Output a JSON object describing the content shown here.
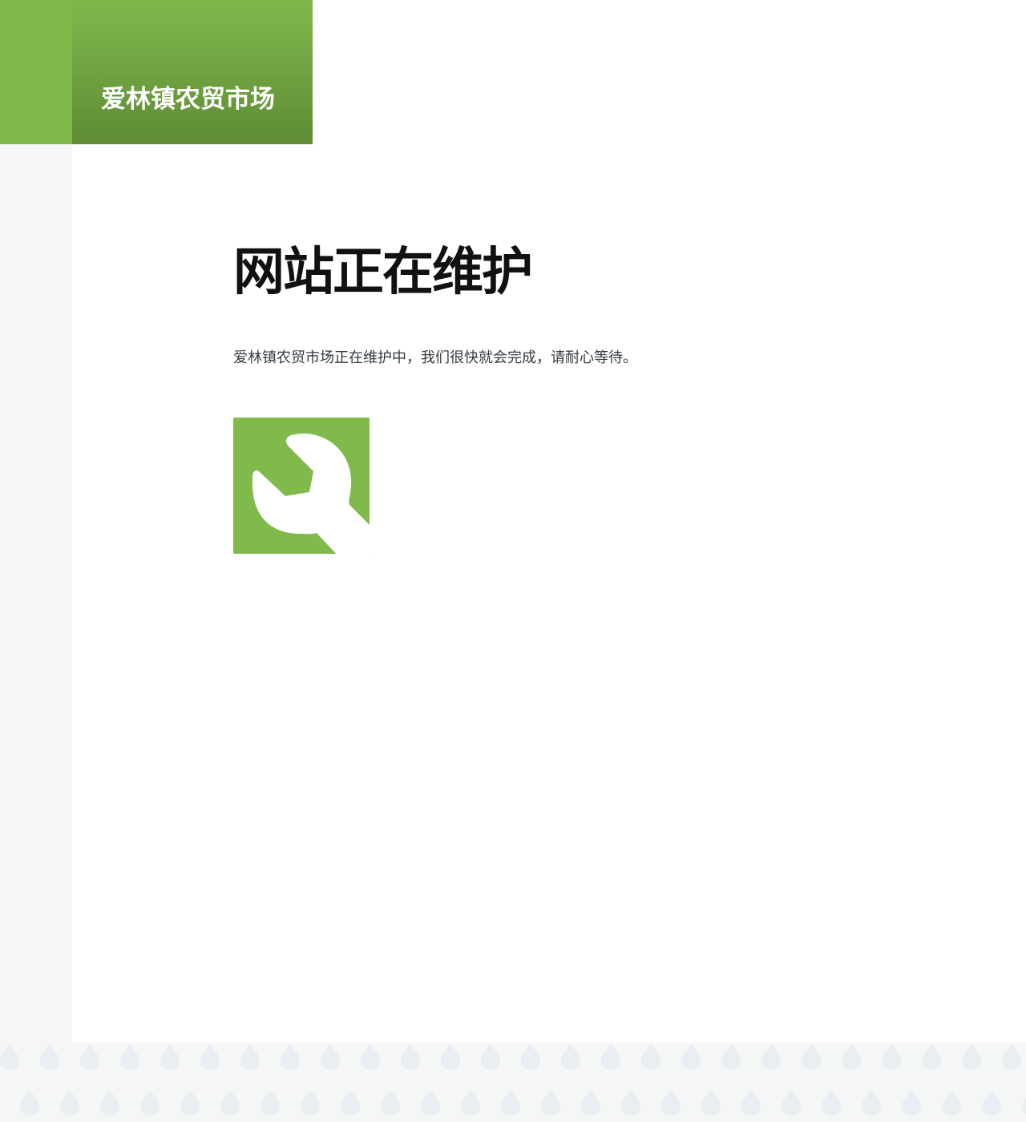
{
  "header": {
    "site_title": "爱林镇农贸市场"
  },
  "main": {
    "heading": "网站正在维护",
    "message": "爱林镇农贸市场正在维护中，我们很快就会完成，请耐心等待。",
    "icon": "wrench-icon"
  },
  "colors": {
    "brand_green": "#80ba4b",
    "brand_green_dark": "#5f8c35",
    "sidebar_bg": "#f5f7f7",
    "drop_pattern": "#e8eef2"
  }
}
